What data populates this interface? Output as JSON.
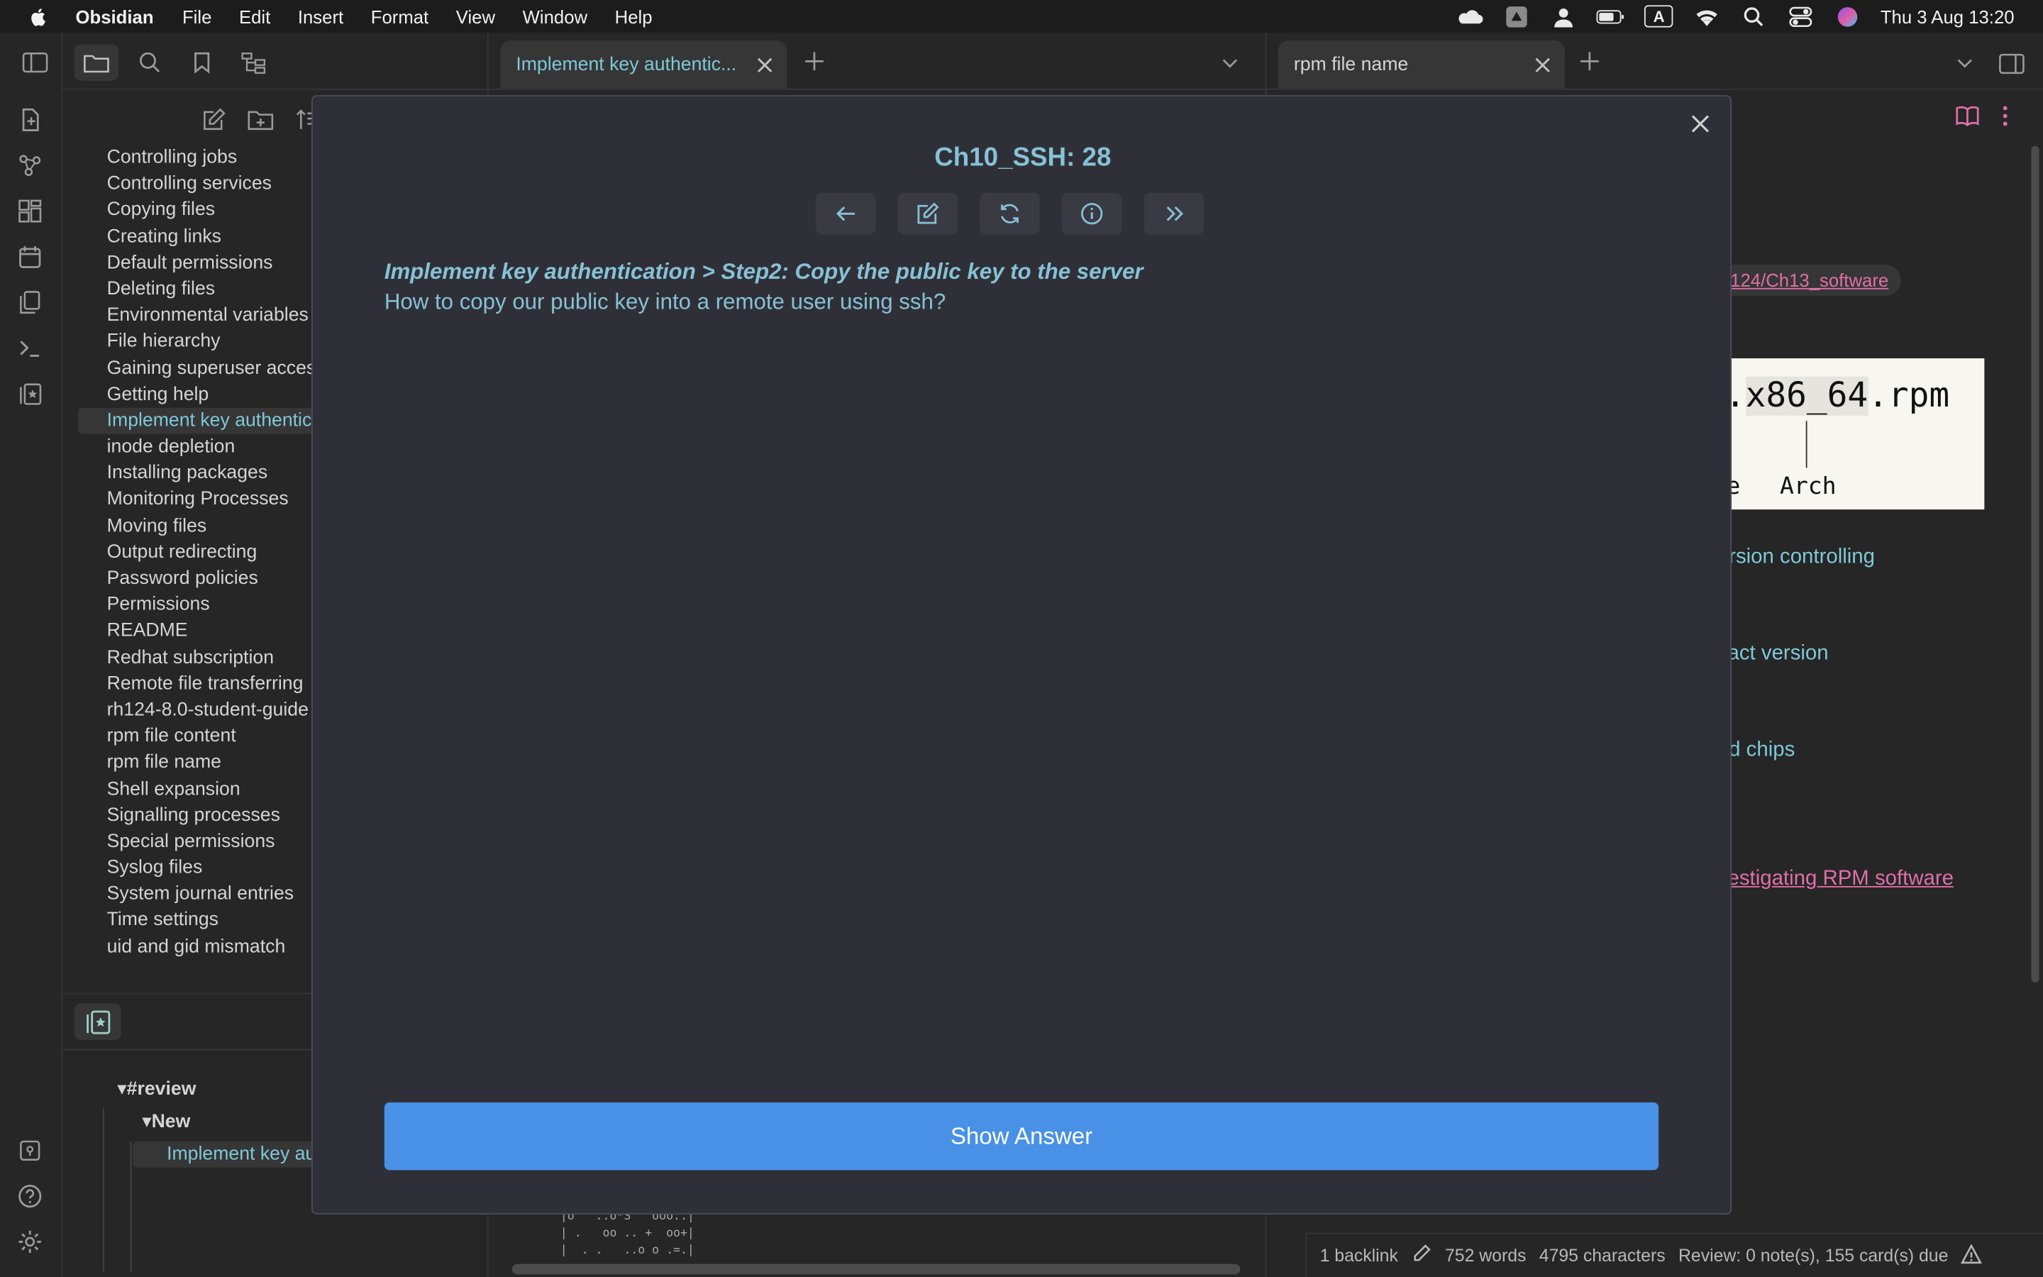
{
  "menubar": {
    "app_name": "Obsidian",
    "menus": [
      "File",
      "Edit",
      "Insert",
      "Format",
      "View",
      "Window",
      "Help"
    ],
    "clock": "Thu 3 Aug  13:20",
    "input_indicator": "A"
  },
  "file_list": [
    "Controlling jobs",
    "Controlling services",
    "Copying files",
    "Creating links",
    "Default permissions",
    "Deleting files",
    "Environmental variables",
    "File hierarchy",
    "Gaining superuser access",
    "Getting help",
    "Implement key authentication",
    "inode depletion",
    "Installing packages",
    "Monitoring Processes",
    "Moving files",
    "Output redirecting",
    "Password policies",
    "Permissions",
    "README",
    "Redhat subscription",
    "Remote file transferring",
    "rh124-8.0-student-guide",
    "rpm file content",
    "rpm file name",
    "Shell expansion",
    "Signalling processes",
    "Special permissions",
    "Syslog files",
    "System journal entries",
    "Time settings",
    "uid and gid mismatch"
  ],
  "active_file_index": 10,
  "review_tree": {
    "tag": "#review",
    "group": "New",
    "item": "Implement key authentication"
  },
  "tabs": {
    "left_active": "Implement key authentic...",
    "right_active": "rpm file name"
  },
  "right_pane": {
    "tag_link": "124/Ch13_software",
    "image_main": ".x86_64.rpm",
    "image_main_highlight": "x86_64",
    "image_label_left": "se",
    "image_label_arch": "Arch",
    "link1": "ersion controlling",
    "link2": "xact version",
    "link3": "ed chips",
    "pink_link": "vestigating RPM software "
  },
  "status_bar": {
    "backlinks": "1 backlink",
    "words": "752 words",
    "characters": "4795 characters",
    "review": "Review: 0 note(s), 155 card(s) due"
  },
  "ascii_art": "|o   ..o*S   ooo..|\n| .   oo .. +  oo+|\n|  . .   ..o o .=.|",
  "modal": {
    "title": "Ch10_SSH: 28",
    "question_path": "Implement key authentication > Step2: Copy the public key to the server",
    "question": "How to copy our public key into a remote user using ssh?",
    "show_answer": "Show Answer",
    "toolbar": [
      "back-icon",
      "edit-icon",
      "refresh-icon",
      "info-icon",
      "skip-icon"
    ]
  },
  "colors": {
    "accent": "#87c1d6",
    "button": "#4891e6",
    "modal_bg": "#2f3037",
    "link_pink": "#e06fa8"
  }
}
